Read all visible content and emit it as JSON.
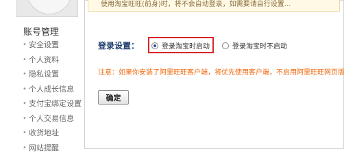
{
  "notice": {
    "text": "使用淘宝旺旺(前身)时，将不会自动登录，如需要请自行设置..."
  },
  "sidebar": {
    "section_title": "账号管理",
    "items": [
      {
        "label": "安全设置"
      },
      {
        "label": "个人资料"
      },
      {
        "label": "隐私设置"
      },
      {
        "label": "个人成长信息"
      },
      {
        "label": "支付宝绑定设置"
      },
      {
        "label": "个人交易信息"
      },
      {
        "label": "收货地址"
      },
      {
        "label": "网站提醒"
      }
    ]
  },
  "login_setting": {
    "label": "登录设置：",
    "options": [
      {
        "label": "登录淘宝时启动",
        "checked": true
      },
      {
        "label": "登录淘宝时不启动",
        "checked": false
      }
    ],
    "warning": "注意：如果你安装了阿里旺旺客户端，将优先使用客户端，不启用阿里旺旺网页版。",
    "confirm_label": "确定"
  },
  "colors": {
    "highlight": "#d9262b",
    "warning": "#f06a0f",
    "label": "#1d3b6c"
  }
}
